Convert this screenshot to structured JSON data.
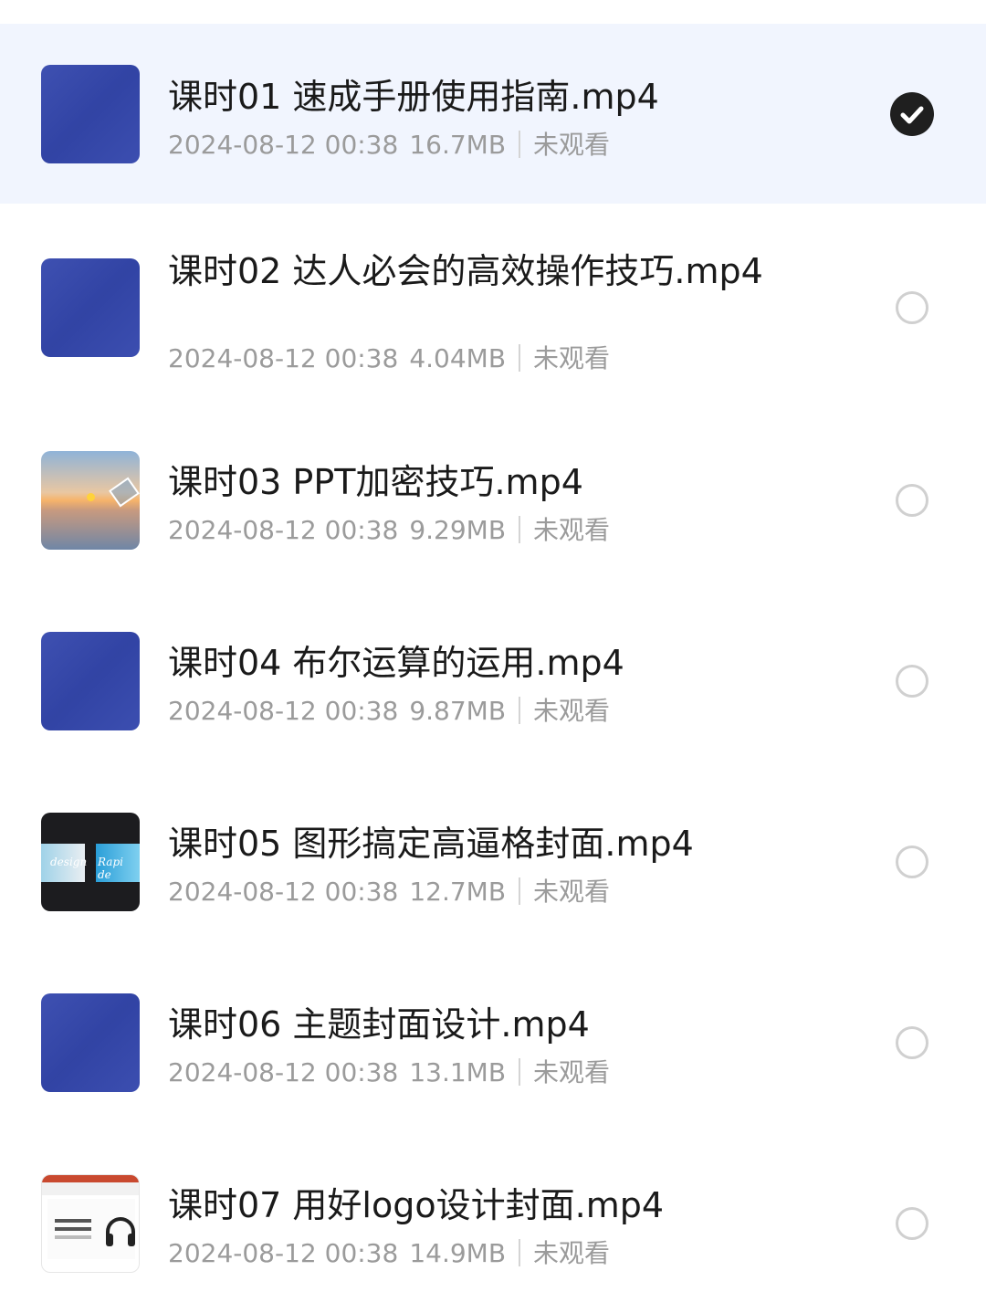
{
  "lessons": [
    {
      "title": "课时01 速成手册使用指南.mp4",
      "date": "2024-08-12 00:38",
      "size": "16.7MB",
      "status": "未观看",
      "thumbnail": "blue-cover",
      "selected": true
    },
    {
      "title": "课时02 达人必会的高效操作技巧.mp4",
      "date": "2024-08-12 00:38",
      "size": "4.04MB",
      "status": "未观看",
      "thumbnail": "blue-cover",
      "selected": false
    },
    {
      "title": "课时03 PPT加密技巧.mp4",
      "date": "2024-08-12 00:38",
      "size": "9.29MB",
      "status": "未观看",
      "thumbnail": "sunset-photo",
      "selected": false
    },
    {
      "title": "课时04 布尔运算的运用.mp4",
      "date": "2024-08-12 00:38",
      "size": "9.87MB",
      "status": "未观看",
      "thumbnail": "blue-cover",
      "selected": false
    },
    {
      "title": "课时05 图形搞定高逼格封面.mp4",
      "date": "2024-08-12 00:38",
      "size": "12.7MB",
      "status": "未观看",
      "thumbnail": "dark-design",
      "selected": false
    },
    {
      "title": "课时06 主题封面设计.mp4",
      "date": "2024-08-12 00:38",
      "size": "13.1MB",
      "status": "未观看",
      "thumbnail": "blue-cover",
      "selected": false
    },
    {
      "title": "课时07 用好logo设计封面.mp4",
      "date": "2024-08-12 00:38",
      "size": "14.9MB",
      "status": "未观看",
      "thumbnail": "slide-preview",
      "selected": false
    }
  ],
  "thumb_text": {
    "design_left": "design",
    "design_right": "Rapi de"
  },
  "colors": {
    "selected_row_bg": "#f1f5fe",
    "cover_blue": "#3447ad",
    "check_fill": "#1f1f1f",
    "meta_gray": "#9b9b9b"
  }
}
